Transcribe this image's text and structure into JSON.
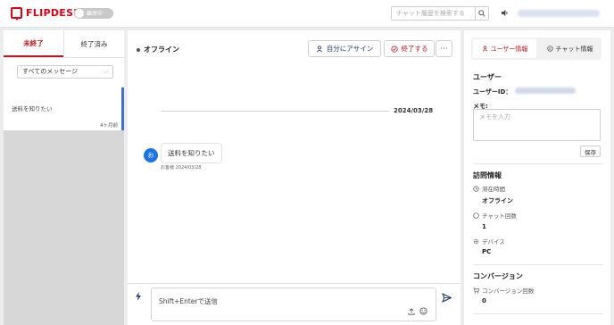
{
  "header": {
    "logo_text": "FLIPDESK",
    "toggle_label": "離席中",
    "search_placeholder": "チャット履歴を検索する"
  },
  "left": {
    "tabs": [
      {
        "label": "未終了"
      },
      {
        "label": "終了済み"
      }
    ],
    "filter_value": "すべてのメッセージ",
    "items": [
      {
        "message": "送料を知りたい",
        "ago": "4ヶ月前"
      }
    ]
  },
  "chat": {
    "status": "オフライン",
    "assign_label": "自分にアサイン",
    "end_label": "終了する",
    "more_label": "···",
    "date": "2024/03/28",
    "avatar_char": "お",
    "message": "送料を知りたい",
    "message_meta": "お客様  2024/03/28",
    "input_placeholder": "Shift+Enterで送信"
  },
  "right": {
    "tabs": [
      {
        "label": "ユーザー情報"
      },
      {
        "label": "チャット情報"
      }
    ],
    "user_title": "ユーザー",
    "user_id_label": "ユーザーID：",
    "memo_label": "メモ:",
    "memo_placeholder": "メモを入力",
    "save_label": "保存",
    "visit_title": "訪問情報",
    "stay_label": "滞在時間",
    "stay_value": "オフライン",
    "chat_count_label": "チャット回数",
    "chat_count_value": "1",
    "device_label": "デバイス",
    "device_value": "PC",
    "conversion_title": "コンバージョン",
    "conversion_count_label": "コンバージョン回数",
    "conversion_count_value": "0"
  },
  "colors": {
    "brand_red": "#e60012",
    "accent_blue": "#1a73e8",
    "selected_border": "#3f6fcf"
  }
}
